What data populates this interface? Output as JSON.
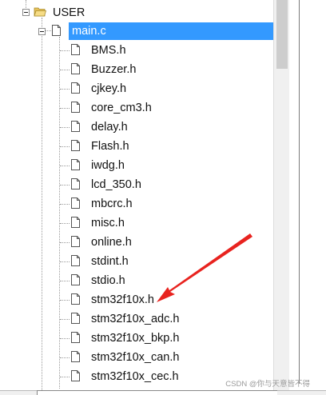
{
  "tree": {
    "folder": {
      "label": "USER",
      "icon": "folder-open-icon"
    },
    "selected_file": {
      "label": "main.c",
      "icon": "file-icon"
    },
    "includes": [
      {
        "label": "BMS.h"
      },
      {
        "label": "Buzzer.h"
      },
      {
        "label": "cjkey.h"
      },
      {
        "label": "core_cm3.h"
      },
      {
        "label": "delay.h"
      },
      {
        "label": "Flash.h"
      },
      {
        "label": "iwdg.h"
      },
      {
        "label": "lcd_350.h"
      },
      {
        "label": "mbcrc.h"
      },
      {
        "label": "misc.h"
      },
      {
        "label": "online.h"
      },
      {
        "label": "stdint.h"
      },
      {
        "label": "stdio.h"
      },
      {
        "label": "stm32f10x.h"
      },
      {
        "label": "stm32f10x_adc.h"
      },
      {
        "label": "stm32f10x_bkp.h"
      },
      {
        "label": "stm32f10x_can.h"
      },
      {
        "label": "stm32f10x_cec.h"
      }
    ]
  },
  "annotation": {
    "arrow_color": "#e8231f",
    "points_to": "stm32f10x.h"
  },
  "colors": {
    "selection": "#3399ff",
    "text": "#111111"
  },
  "watermark": "CSDN @你与天意皆不得"
}
